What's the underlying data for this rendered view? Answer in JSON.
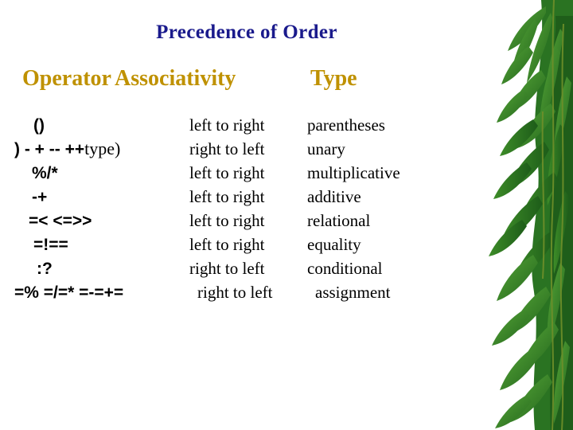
{
  "slide": {
    "title": "Precedence of Order",
    "title_color": "#1a1a8c",
    "header_color": "#bf9100",
    "background_color": "#ffffff"
  },
  "table": {
    "headers": {
      "operator": "Operator",
      "associativity": "Associativity",
      "type": "Type"
    },
    "rows": [
      {
        "operator": "()",
        "operator_tail": "",
        "associativity": "left to right",
        "type": "parentheses"
      },
      {
        "operator": ") - + -- ++",
        "operator_tail": "type)",
        "associativity": "right to left",
        "type": "unary"
      },
      {
        "operator": "%/*",
        "operator_tail": "",
        "associativity": "left to right",
        "type": "multiplicative"
      },
      {
        "operator": "-+",
        "operator_tail": "",
        "associativity": "left to right",
        "type": "additive"
      },
      {
        "operator": "=< <=>>",
        "operator_tail": "",
        "associativity": "left to right",
        "type": "relational"
      },
      {
        "operator": "=!==",
        "operator_tail": "",
        "associativity": "left to right",
        "type": "equality"
      },
      {
        "operator": ":?",
        "operator_tail": "",
        "associativity": "right to left",
        "type": "conditional"
      },
      {
        "operator": "=% =/=* =-=+=",
        "operator_tail": "",
        "associativity": "right to left",
        "type": "assignment"
      }
    ]
  },
  "decoration": {
    "name": "bamboo-leaves-image",
    "leaf_dark": "#1d5c19",
    "leaf_mid": "#2f7c24",
    "leaf_light": "#4f9e33",
    "stem": "#6f8f2a"
  }
}
